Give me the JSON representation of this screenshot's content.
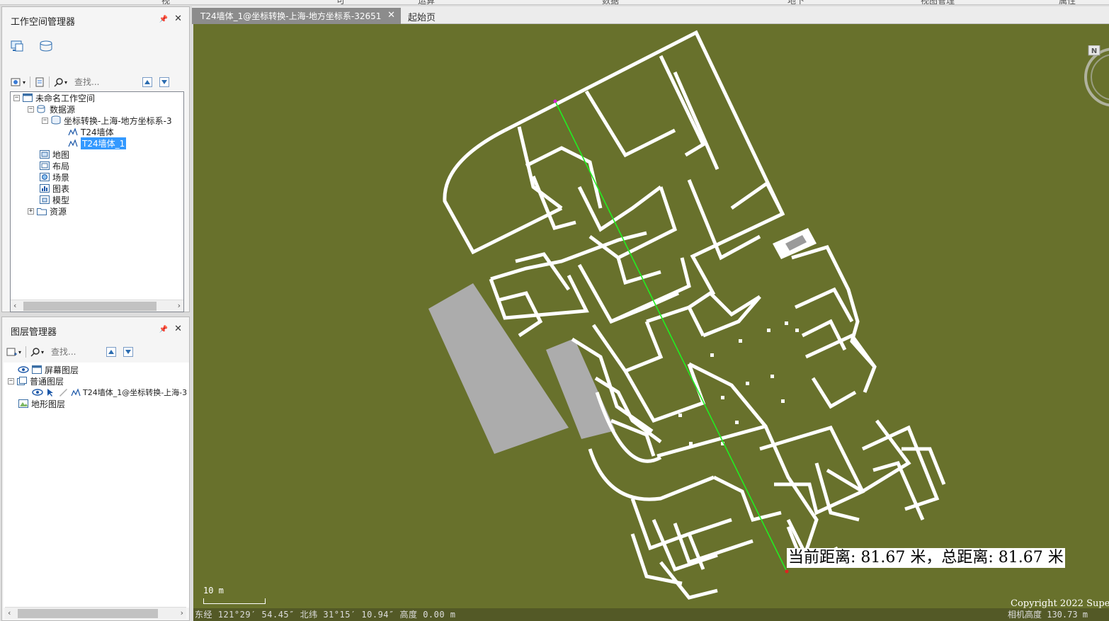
{
  "ws_panel": {
    "title": "工作空间管理器",
    "search_placeholder": "查找...",
    "tree": {
      "workspace": "未命名工作空间",
      "datasource_group": "数据源",
      "datasource": "坐标转换-上海-地方坐标系-3",
      "dataset_1": "T24墙体",
      "dataset_2": "T24墙体_1",
      "map": "地图",
      "layout": "布局",
      "scene": "场景",
      "chart": "图表",
      "model": "模型",
      "resource": "资源"
    }
  },
  "layer_panel": {
    "title": "图层管理器",
    "search_placeholder": "查找...",
    "tree": {
      "screen_layer": "屏幕图层",
      "normal_layer": "普通图层",
      "layer_item": "T24墙体_1@坐标转换-上海-3",
      "terrain_layer": "地形图层"
    }
  },
  "tabs": {
    "active": "T24墙体_1@坐标转换-上海-地方坐标系-32651",
    "start": "起始页"
  },
  "scene": {
    "measure_label": "当前距离: 81.67 米，总距离: 81.67 米",
    "scale_label": "10 m",
    "status_coords": "东经 121°29′ 54.45″   北纬 31°15′ 10.94″   高度 0.00 m",
    "copyright": "Copyright 2022 Supe",
    "camera_height": "相机高度 130.73 m",
    "compass_label": "N",
    "background_color": "#68712c",
    "measure_line_color": "#22ee22"
  }
}
